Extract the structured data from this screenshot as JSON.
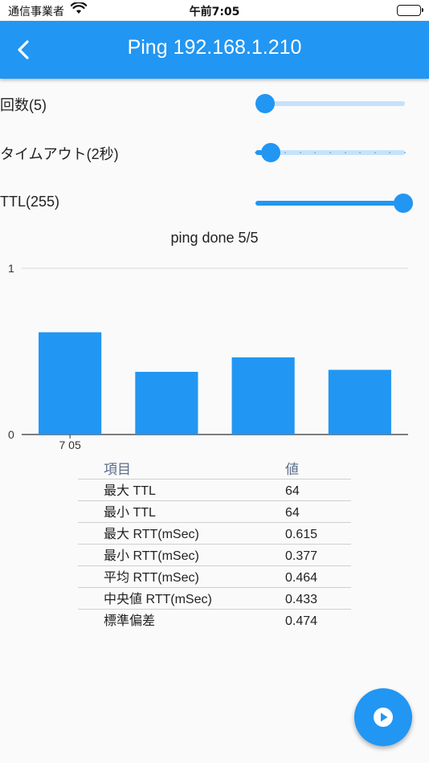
{
  "status_bar": {
    "carrier": "通信事業者",
    "time": "午前7:05"
  },
  "app_bar": {
    "title": "Ping 192.168.1.210"
  },
  "settings": {
    "count": {
      "label": "回数(5)",
      "fraction": 0.0
    },
    "timeout": {
      "label": "タイムアウト(2秒)",
      "fraction": 0.1,
      "divisions": 10
    },
    "ttl": {
      "label": "TTL(255)",
      "fraction": 1.0
    }
  },
  "chart_title": "ping done 5/5",
  "chart_data": {
    "type": "bar",
    "categories": [
      "7 05",
      "",
      "",
      ""
    ],
    "values": [
      0.615,
      0.377,
      0.464,
      0.389
    ],
    "ylim": [
      0,
      1
    ],
    "yticks": [
      "0",
      "1"
    ],
    "bar_color": "#2196f3",
    "grid": true
  },
  "stats": {
    "headers": [
      "項目",
      "値"
    ],
    "rows": [
      [
        "最大 TTL",
        "64"
      ],
      [
        "最小 TTL",
        "64"
      ],
      [
        "最大 RTT(mSec)",
        "0.615"
      ],
      [
        "最小 RTT(mSec)",
        "0.377"
      ],
      [
        "平均 RTT(mSec)",
        "0.464"
      ],
      [
        "中央値 RTT(mSec)",
        "0.433"
      ],
      [
        "標準偏差",
        "0.474"
      ]
    ]
  },
  "icons": {
    "back": "chevron-left-icon",
    "fab": "play-circle-icon",
    "wifi": "wifi-icon",
    "battery": "battery-icon"
  },
  "colors": {
    "primary": "#2196f3",
    "track_inactive": "#c5e2fb",
    "header_text": "#5c6f8a"
  }
}
